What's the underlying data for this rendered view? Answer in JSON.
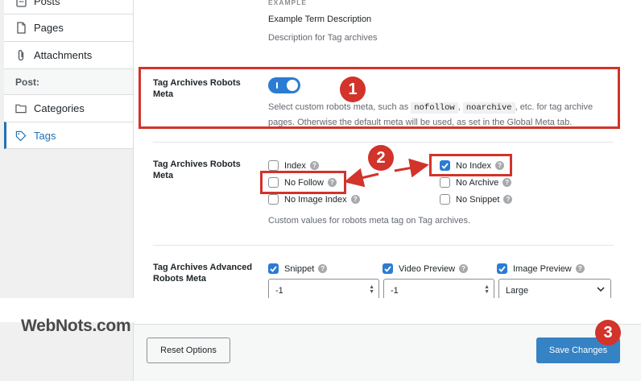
{
  "sidebar": {
    "items": [
      {
        "label": "Posts",
        "icon": "document-icon"
      },
      {
        "label": "Pages",
        "icon": "page-icon"
      },
      {
        "label": "Attachments",
        "icon": "paperclip-icon"
      }
    ],
    "post_heading": "Post:",
    "post_items": [
      {
        "label": "Categories",
        "icon": "folder-icon"
      },
      {
        "label": "Tags",
        "icon": "tag-icon"
      }
    ]
  },
  "example": {
    "heading": "EXAMPLE",
    "term": "Example Term Description",
    "description": "Description for Tag archives"
  },
  "robots_toggle": {
    "label": "Tag Archives Robots Meta",
    "enabled": true,
    "desc_prefix": "Select custom robots meta, such as",
    "code1": "nofollow",
    "comma": ",",
    "code2": "noarchive",
    "desc_mid": ", etc. for tag archive",
    "desc_line2": "pages. Otherwise the default meta will be used, as set in the Global Meta tab."
  },
  "robots_meta": {
    "label": "Tag Archives Robots Meta",
    "options": [
      {
        "label": "Index",
        "checked": false
      },
      {
        "label": "No Index",
        "checked": true
      },
      {
        "label": "No Follow",
        "checked": false
      },
      {
        "label": "No Archive",
        "checked": false
      },
      {
        "label": "No Image Index",
        "checked": false
      },
      {
        "label": "No Snippet",
        "checked": false
      }
    ],
    "help": "?",
    "caption": "Custom values for robots meta tag on Tag archives."
  },
  "advanced": {
    "label": "Tag Archives Advanced Robots Meta",
    "options": [
      {
        "label": "Snippet",
        "checked": true,
        "value": "-1"
      },
      {
        "label": "Video Preview",
        "checked": true,
        "value": "-1"
      },
      {
        "label": "Image Preview",
        "checked": true,
        "value": "Large"
      }
    ]
  },
  "footer": {
    "reset_label": "Reset Options",
    "save_label": "Save Changes"
  },
  "annotations": [
    "1",
    "2",
    "3"
  ],
  "watermark": "WebNots.com",
  "colors": {
    "accent": "#2b7cd3",
    "annotation": "#d2332a",
    "save_button": "#3582c4"
  }
}
